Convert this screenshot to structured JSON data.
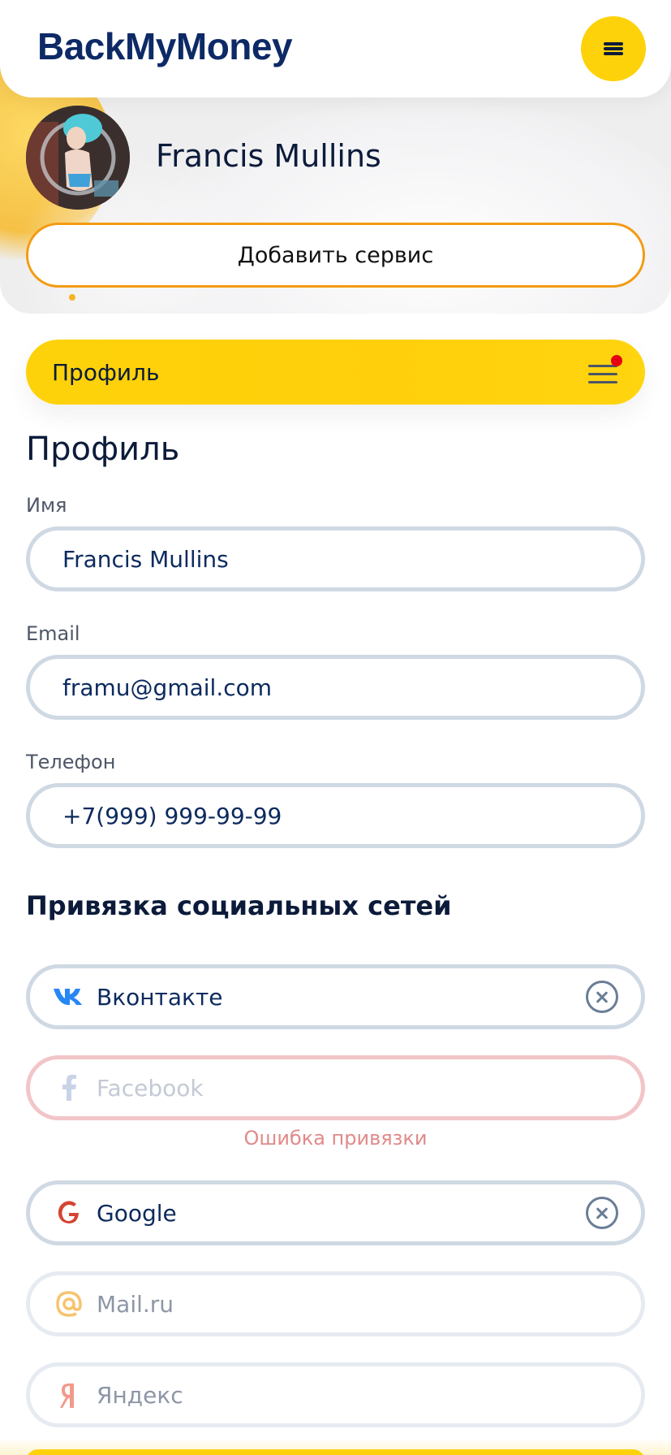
{
  "header": {
    "logo": "BackMyMoney",
    "menu_icon": "menu-icon"
  },
  "profile": {
    "name": "Francis Mullins",
    "add_service_label": "Добавить сервис"
  },
  "section_selector": {
    "label": "Профиль",
    "has_notification": true
  },
  "form": {
    "title": "Профиль",
    "name_label": "Имя",
    "name_value": "Francis Mullins",
    "email_label": "Email",
    "email_value": "framu@gmail.com",
    "phone_label": "Телефон",
    "phone_value": "+7(999) 999-99-99"
  },
  "social": {
    "title": "Привязка социальных сетей",
    "items": [
      {
        "label": "Вконтакте",
        "icon": "vk-icon",
        "state": "linked"
      },
      {
        "label": "Facebook",
        "icon": "facebook-icon",
        "state": "error",
        "error": "Ошибка привязки"
      },
      {
        "label": "Google",
        "icon": "google-icon",
        "state": "linked"
      },
      {
        "label": "Mail.ru",
        "icon": "mailru-icon",
        "state": "unlinked"
      },
      {
        "label": "Яндекс",
        "icon": "yandex-icon",
        "state": "unlinked"
      }
    ]
  },
  "colors": {
    "accent_yellow": "#fdd20a",
    "accent_orange": "#f39b12",
    "brand_navy": "#0d2a66",
    "error_red": "#e08a8a"
  }
}
